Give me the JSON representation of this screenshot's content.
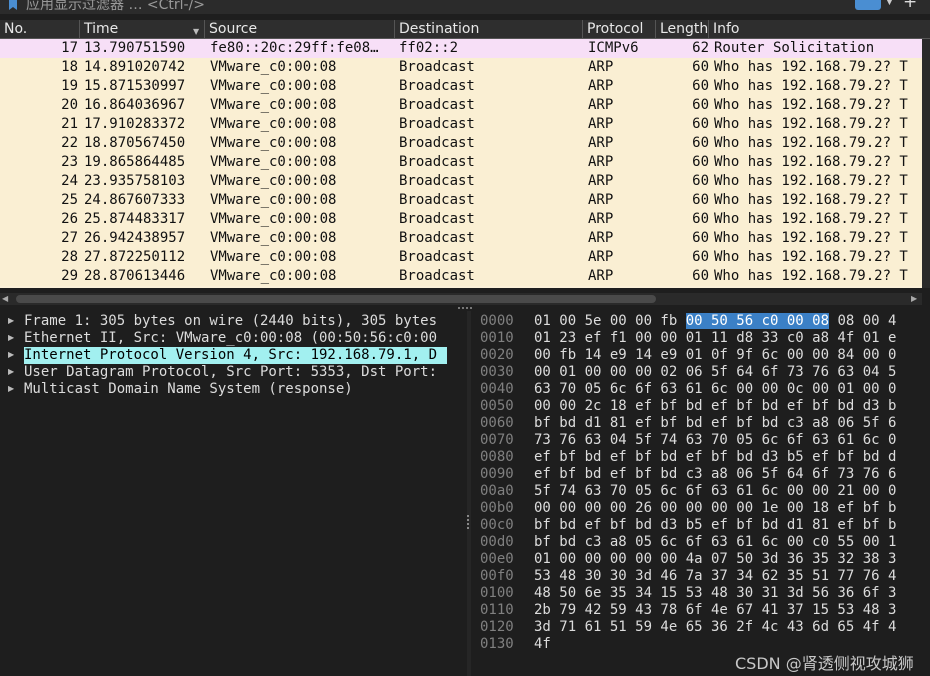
{
  "filter": {
    "placeholder": "应用显示过滤器 … <Ctrl-/>"
  },
  "columns": [
    "No.",
    "Time",
    "Source",
    "Destination",
    "Protocol",
    "Length",
    "Info"
  ],
  "packets": [
    {
      "no": "17",
      "time": "13.790751590",
      "src": "fe80::20c:29ff:fe08…",
      "dst": "ff02::2",
      "proto": "ICMPv6",
      "len": "62",
      "info": "Router Solicitation"
    },
    {
      "no": "18",
      "time": "14.891020742",
      "src": "VMware_c0:00:08",
      "dst": "Broadcast",
      "proto": "ARP",
      "len": "60",
      "info": "Who has 192.168.79.2? T"
    },
    {
      "no": "19",
      "time": "15.871530997",
      "src": "VMware_c0:00:08",
      "dst": "Broadcast",
      "proto": "ARP",
      "len": "60",
      "info": "Who has 192.168.79.2? T"
    },
    {
      "no": "20",
      "time": "16.864036967",
      "src": "VMware_c0:00:08",
      "dst": "Broadcast",
      "proto": "ARP",
      "len": "60",
      "info": "Who has 192.168.79.2? T"
    },
    {
      "no": "21",
      "time": "17.910283372",
      "src": "VMware_c0:00:08",
      "dst": "Broadcast",
      "proto": "ARP",
      "len": "60",
      "info": "Who has 192.168.79.2? T"
    },
    {
      "no": "22",
      "time": "18.870567450",
      "src": "VMware_c0:00:08",
      "dst": "Broadcast",
      "proto": "ARP",
      "len": "60",
      "info": "Who has 192.168.79.2? T"
    },
    {
      "no": "23",
      "time": "19.865864485",
      "src": "VMware_c0:00:08",
      "dst": "Broadcast",
      "proto": "ARP",
      "len": "60",
      "info": "Who has 192.168.79.2? T"
    },
    {
      "no": "24",
      "time": "23.935758103",
      "src": "VMware_c0:00:08",
      "dst": "Broadcast",
      "proto": "ARP",
      "len": "60",
      "info": "Who has 192.168.79.2? T"
    },
    {
      "no": "25",
      "time": "24.867607333",
      "src": "VMware_c0:00:08",
      "dst": "Broadcast",
      "proto": "ARP",
      "len": "60",
      "info": "Who has 192.168.79.2? T"
    },
    {
      "no": "26",
      "time": "25.874483317",
      "src": "VMware_c0:00:08",
      "dst": "Broadcast",
      "proto": "ARP",
      "len": "60",
      "info": "Who has 192.168.79.2? T"
    },
    {
      "no": "27",
      "time": "26.942438957",
      "src": "VMware_c0:00:08",
      "dst": "Broadcast",
      "proto": "ARP",
      "len": "60",
      "info": "Who has 192.168.79.2? T"
    },
    {
      "no": "28",
      "time": "27.872250112",
      "src": "VMware_c0:00:08",
      "dst": "Broadcast",
      "proto": "ARP",
      "len": "60",
      "info": "Who has 192.168.79.2? T"
    },
    {
      "no": "29",
      "time": "28.870613446",
      "src": "VMware_c0:00:08",
      "dst": "Broadcast",
      "proto": "ARP",
      "len": "60",
      "info": "Who has 192.168.79.2? T"
    }
  ],
  "details": [
    {
      "text": "Frame 1: 305 bytes on wire (2440 bits), 305 bytes",
      "selected": false
    },
    {
      "text": "Ethernet II, Src: VMware_c0:00:08 (00:50:56:c0:00",
      "selected": false
    },
    {
      "text": "Internet Protocol Version 4, Src: 192.168.79.1, D",
      "selected": true
    },
    {
      "text": "User Datagram Protocol, Src Port: 5353, Dst Port:",
      "selected": false
    },
    {
      "text": "Multicast Domain Name System (response)",
      "selected": false
    }
  ],
  "bytes": [
    {
      "offset": "0000",
      "pre": "01 00 5e 00 00 fb ",
      "hl": "00 50  56 c0 00 08",
      "post": " 08 00 4"
    },
    {
      "offset": "0010",
      "pre": "01 23 ef f1 00 00 01 11  d8 33 c0 a8 4f 01 e",
      "hl": "",
      "post": ""
    },
    {
      "offset": "0020",
      "pre": "00 fb 14 e9 14 e9 01 0f  9f 6c 00 00 84 00 0",
      "hl": "",
      "post": ""
    },
    {
      "offset": "0030",
      "pre": "00 01 00 00 00 02 06 5f  64 6f 73 76 63 04 5",
      "hl": "",
      "post": ""
    },
    {
      "offset": "0040",
      "pre": "63 70 05 6c 6f 63 61 6c  00 00 0c 00 01 00 0",
      "hl": "",
      "post": ""
    },
    {
      "offset": "0050",
      "pre": "00 00 2c 18 ef bf bd ef  bf bd ef bf bd d3 b",
      "hl": "",
      "post": ""
    },
    {
      "offset": "0060",
      "pre": "bf bd d1 81 ef bf bd ef  bf bd c3 a8 06 5f 6",
      "hl": "",
      "post": ""
    },
    {
      "offset": "0070",
      "pre": "73 76 63 04 5f 74 63 70  05 6c 6f 63 61 6c 0",
      "hl": "",
      "post": ""
    },
    {
      "offset": "0080",
      "pre": "ef bf bd ef bf bd ef bf  bd d3 b5 ef bf bd d",
      "hl": "",
      "post": ""
    },
    {
      "offset": "0090",
      "pre": "ef bf bd ef bf bd c3 a8  06 5f 64 6f 73 76 6",
      "hl": "",
      "post": ""
    },
    {
      "offset": "00a0",
      "pre": "5f 74 63 70 05 6c 6f 63  61 6c 00 00 21 00 0",
      "hl": "",
      "post": ""
    },
    {
      "offset": "00b0",
      "pre": "00 00 00 00 26 00 00 00  00 1e 00 18 ef bf b",
      "hl": "",
      "post": ""
    },
    {
      "offset": "00c0",
      "pre": "bf bd ef bf bd d3 b5 ef  bf bd d1 81 ef bf b",
      "hl": "",
      "post": ""
    },
    {
      "offset": "00d0",
      "pre": "bf bd c3 a8 05 6c 6f 63  61 6c 00 c0 55 00 1",
      "hl": "",
      "post": ""
    },
    {
      "offset": "00e0",
      "pre": "01 00 00 00 00 00 4a 07  50 3d 36 35 32 38 3",
      "hl": "",
      "post": ""
    },
    {
      "offset": "00f0",
      "pre": "53 48 30 30 3d 46 7a 37  34 62 35 51 77 76 4",
      "hl": "",
      "post": ""
    },
    {
      "offset": "0100",
      "pre": "48 50 6e 35 34 15 53 48  30 31 3d 56 36 6f 3",
      "hl": "",
      "post": ""
    },
    {
      "offset": "0110",
      "pre": "2b 79 42 59 43 78 6f 4e  67 41 37 15 53 48 3",
      "hl": "",
      "post": ""
    },
    {
      "offset": "0120",
      "pre": "3d 71 61 51 59 4e 65 36  2f 4c 43 6d 65 4f 4",
      "hl": "",
      "post": ""
    },
    {
      "offset": "0130",
      "pre": "4f",
      "hl": "",
      "post": ""
    }
  ],
  "watermark": "CSDN @肾透侧视攻城狮",
  "colors": {
    "arp_row": "#faefd3",
    "icmpv6_row": "#f7dff7",
    "tree_selection": "#a2f0f0",
    "byte_highlight": "#3b80c6"
  }
}
